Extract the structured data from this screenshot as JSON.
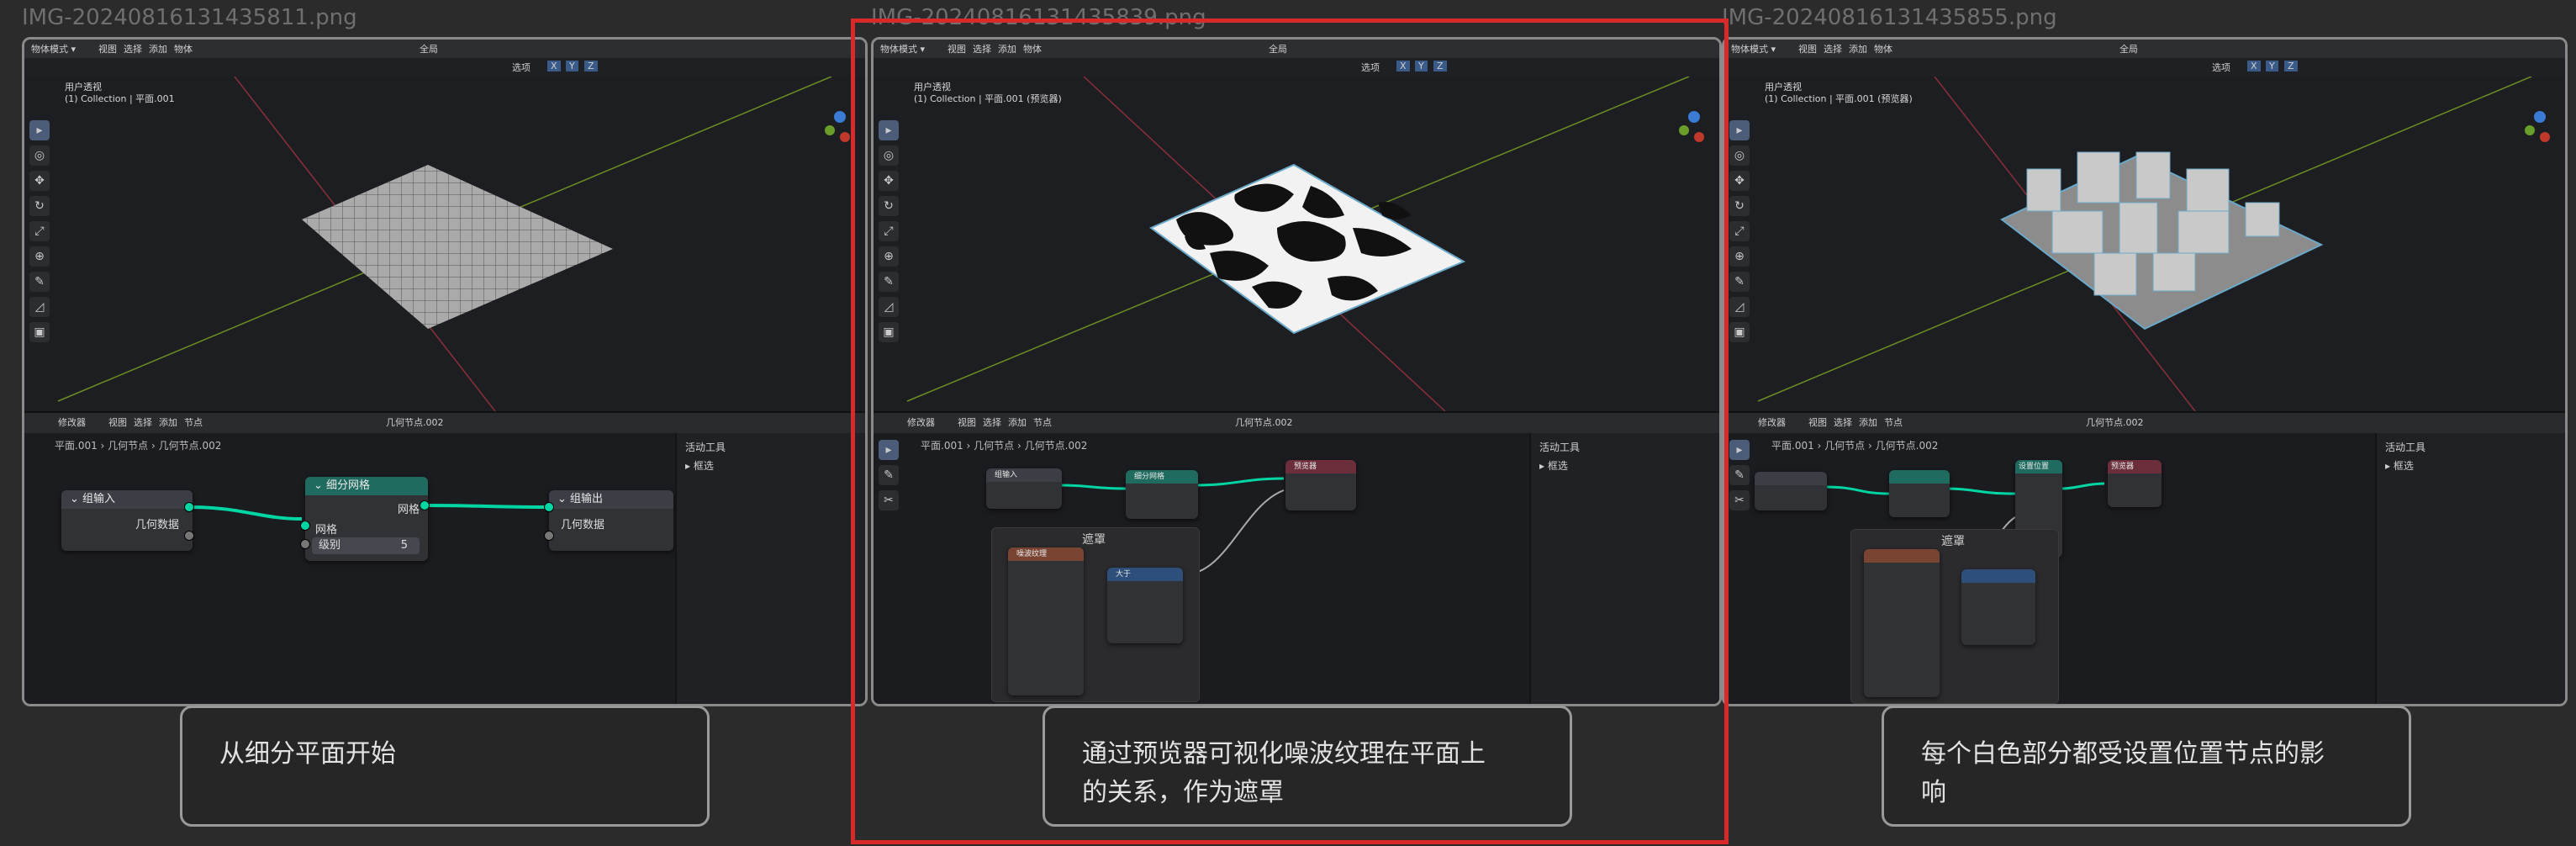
{
  "images": [
    {
      "title": "IMG-20240816131435811.png"
    },
    {
      "title": "IMG-20240816131435839.png"
    },
    {
      "title": "IMG-20240816131435855.png"
    }
  ],
  "blender": {
    "mode_label": "物体模式",
    "menu": [
      "视图",
      "选择",
      "添加",
      "物体"
    ],
    "global_label": "全局",
    "xyz": [
      "X",
      "Y",
      "Z"
    ],
    "select_label": "选项",
    "viewport_view": "用户透视",
    "node_editor_menu": [
      "视图",
      "选择",
      "添加",
      "节点"
    ],
    "editor_type": "修改器",
    "nodegroup_name": "几何节点.002",
    "sidebar_title": "活动工具",
    "sidebar_select": "框选",
    "colors": {
      "accent": "#00d6a3",
      "highlight": "#d82a2a",
      "bg": "#1e1f22"
    }
  },
  "panel1": {
    "collection_label": "(1) Collection | 平面.001",
    "breadcrumb": [
      "平面.001",
      "几何节点",
      "几何节点.002"
    ],
    "node_input": {
      "title": "组输入",
      "socket": "几何数据"
    },
    "node_subdivide": {
      "title": "细分网格",
      "out": "网格",
      "in": "网格",
      "level_label": "级别",
      "level_value": "5"
    },
    "node_output": {
      "title": "组输出",
      "socket": "几何数据"
    }
  },
  "panel2": {
    "collection_label": "(1) Collection | 平面.001 (预览器)",
    "breadcrumb": [
      "平面.001",
      "几何节点",
      "几何节点.002"
    ],
    "frame_label": "遮罩",
    "node_input": "组输入",
    "node_subdivide": "细分网格",
    "node_viewer": "预览器",
    "node_noise": "噪波纹理",
    "node_compare": "大于"
  },
  "panel3": {
    "collection_label": "(1) Collection | 平面.001 (预览器)",
    "breadcrumb": [
      "平面.001",
      "几何节点",
      "几何节点.002"
    ],
    "frame_label": "遮罩",
    "node_setpos": "设置位置",
    "node_viewer": "预览器"
  },
  "captions": [
    {
      "text": "从细分平面开始"
    },
    {
      "line1": "通过预览器可视化噪波纹理在平面上",
      "line2": "的关系，作为遮罩"
    },
    {
      "line1": "每个白色部分都受设置位置节点的影",
      "line2": "响"
    }
  ]
}
